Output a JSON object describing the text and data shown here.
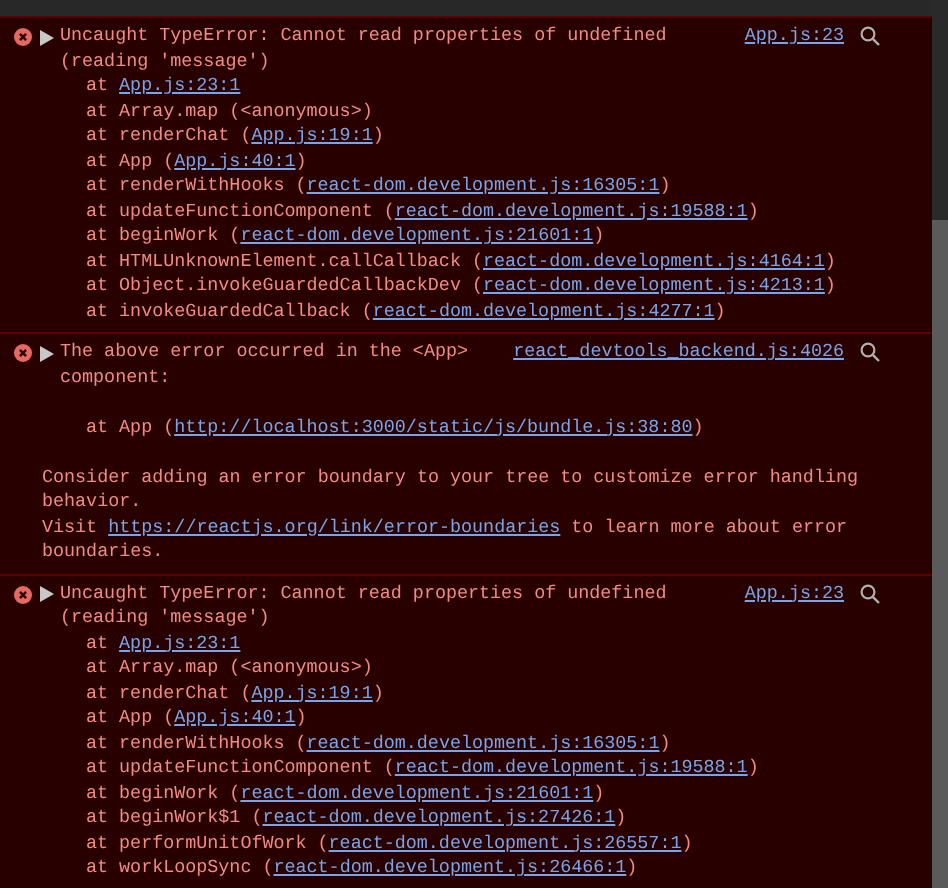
{
  "console": {
    "messages": [
      {
        "kind": "error",
        "expanded": false,
        "header": "Uncaught TypeError: Cannot read properties of undefined\n(reading 'message')",
        "source": "App.js:23",
        "lines": [
          {
            "kind": "frame",
            "text": "at ",
            "link": "App.js:23:1"
          },
          {
            "kind": "frame",
            "text": "at Array.map (<anonymous>)"
          },
          {
            "kind": "frame",
            "text": "at renderChat (",
            "link": "App.js:19:1",
            "tail": ")"
          },
          {
            "kind": "frame",
            "text": "at App (",
            "link": "App.js:40:1",
            "tail": ")"
          },
          {
            "kind": "frame",
            "text": "at renderWithHooks (",
            "link": "react-dom.development.js:16305:1",
            "tail": ")"
          },
          {
            "kind": "frame",
            "text": "at updateFunctionComponent (",
            "link": "react-dom.development.js:19588:1",
            "tail": ")"
          },
          {
            "kind": "frame",
            "text": "at beginWork (",
            "link": "react-dom.development.js:21601:1",
            "tail": ")"
          },
          {
            "kind": "frame",
            "text": "at HTMLUnknownElement.callCallback (",
            "link": "react-dom.development.js:4164:1",
            "tail": ")"
          },
          {
            "kind": "frame",
            "text": "at Object.invokeGuardedCallbackDev (",
            "link": "react-dom.development.js:4213:1",
            "tail": ")"
          },
          {
            "kind": "frame",
            "text": "at invokeGuardedCallback (",
            "link": "react-dom.development.js:4277:1",
            "tail": ")"
          }
        ]
      },
      {
        "kind": "error",
        "expanded": false,
        "header": "The above error occurred in the <App>\ncomponent:",
        "source": "react_devtools_backend.js:4026",
        "lines": [
          {
            "kind": "blank"
          },
          {
            "kind": "frame",
            "text": "at App (",
            "link": "http://localhost:3000/static/js/bundle.js:38:80",
            "tail": ")"
          },
          {
            "kind": "blank"
          },
          {
            "kind": "text",
            "text": "Consider adding an error boundary to your tree to customize error handling\nbehavior.\nVisit ",
            "link": "https://reactjs.org/link/error-boundaries",
            "tail": " to learn more about error\nboundaries."
          }
        ]
      },
      {
        "kind": "error",
        "expanded": false,
        "header": "Uncaught TypeError: Cannot read properties of undefined\n(reading 'message')",
        "source": "App.js:23",
        "lines": [
          {
            "kind": "frame",
            "text": "at ",
            "link": "App.js:23:1"
          },
          {
            "kind": "frame",
            "text": "at Array.map (<anonymous>)"
          },
          {
            "kind": "frame",
            "text": "at renderChat (",
            "link": "App.js:19:1",
            "tail": ")"
          },
          {
            "kind": "frame",
            "text": "at App (",
            "link": "App.js:40:1",
            "tail": ")"
          },
          {
            "kind": "frame",
            "text": "at renderWithHooks (",
            "link": "react-dom.development.js:16305:1",
            "tail": ")"
          },
          {
            "kind": "frame",
            "text": "at updateFunctionComponent (",
            "link": "react-dom.development.js:19588:1",
            "tail": ")"
          },
          {
            "kind": "frame",
            "text": "at beginWork (",
            "link": "react-dom.development.js:21601:1",
            "tail": ")"
          },
          {
            "kind": "frame",
            "text": "at beginWork$1 (",
            "link": "react-dom.development.js:27426:1",
            "tail": ")"
          },
          {
            "kind": "frame",
            "text": "at performUnitOfWork (",
            "link": "react-dom.development.js:26557:1",
            "tail": ")"
          },
          {
            "kind": "frame",
            "text": "at workLoopSync (",
            "link": "react-dom.development.js:26466:1",
            "tail": ")"
          }
        ]
      }
    ]
  }
}
